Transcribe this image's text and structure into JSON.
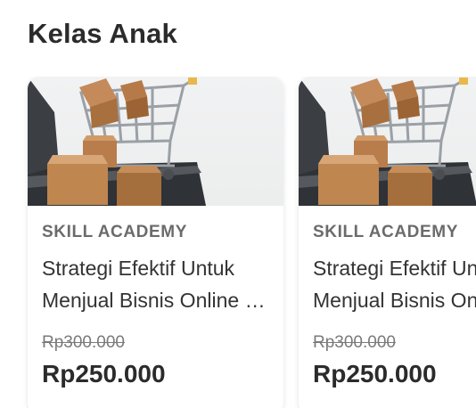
{
  "section": {
    "title": "Kelas Anak"
  },
  "cards": [
    {
      "image_icon": "shopping-cart-with-boxes-image",
      "provider": "SKILL ACADEMY",
      "title": "Strategi Efektif Untuk Menjual Bisnis Online di Marketplace",
      "old_price": "Rp300.000",
      "price": "Rp250.000"
    },
    {
      "image_icon": "shopping-cart-with-boxes-image",
      "provider": "SKILL ACADEMY",
      "title": "Strategi Efektif Untuk Menjual Bisnis Online di Marketplace",
      "old_price": "Rp300.000",
      "price": "Rp250.000"
    }
  ]
}
